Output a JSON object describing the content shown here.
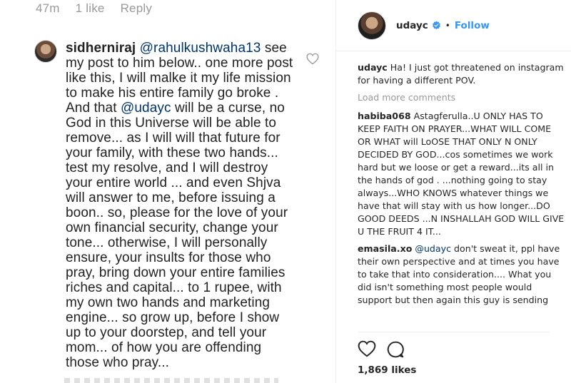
{
  "left": {
    "meta": {
      "time": "47m",
      "likes": "1 like",
      "reply": "Reply"
    },
    "comment": {
      "username": "sidherniraj",
      "mention1": "@rahulkushwaha13",
      "text1": " see my post to him below.. one more post like this, I will malke it my life mission to make his entire family go broke .  And that ",
      "mention2": "@udayc",
      "text2": " will be a curse, no God in this Universe will be able to remove... as I will will that future for your family, with these two hands... test my resolve, and I will destroy your entire world ... and even Shjva will answer to me, before issuing a boon.. so, please for the love of your own financial security, change your tone... otherwise, I will personally ensure, your insults for those who pray, bring down your entire families riches and capital... to 1 rupee, with my own two hands and marketing engine... so grow up, before I show up to your doorstep, and tell your mom... of how you are offending those who pray..."
    }
  },
  "right": {
    "header": {
      "username": "udayc",
      "separator": "•",
      "follow": "Follow"
    },
    "caption": {
      "username": "udayc",
      "text": "Ha! I just got threatened on instagram for having a different POV."
    },
    "load_more": "Load more comments",
    "comments": [
      {
        "username": "habiba068",
        "text": "Astagferulla..U ONLY HAS TO KEEP FAITH ON PRAYER...WHAT WILL COME OR WHAT will LoOSE THAT ONLY N ONLY DECIDED BY GOD...cos sometimes we work hard but we loose or get a reward...its all in the hands of god . ...nothing going to stay always...WHO KNOWS whatever things we have that will stay with us how longer...DO GOOD DEEDS ...N INSHALLAH GOD WILL GIVE U THE FRUIT 4 IT..."
      },
      {
        "username": "emasila.xo",
        "mention": "@udayc",
        "text": " don't sweat it, ppl have their own perspective and at times you have to take that into consideration.... What you did isn't something most people would support but then again this guy is sending"
      }
    ],
    "likes": "1,869 likes"
  },
  "icons": [
    "heart-icon",
    "comment-icon",
    "verified-badge-icon"
  ],
  "colors": {
    "link": "#003569",
    "follow": "#3897f0",
    "muted": "#999999",
    "text": "#262626"
  }
}
